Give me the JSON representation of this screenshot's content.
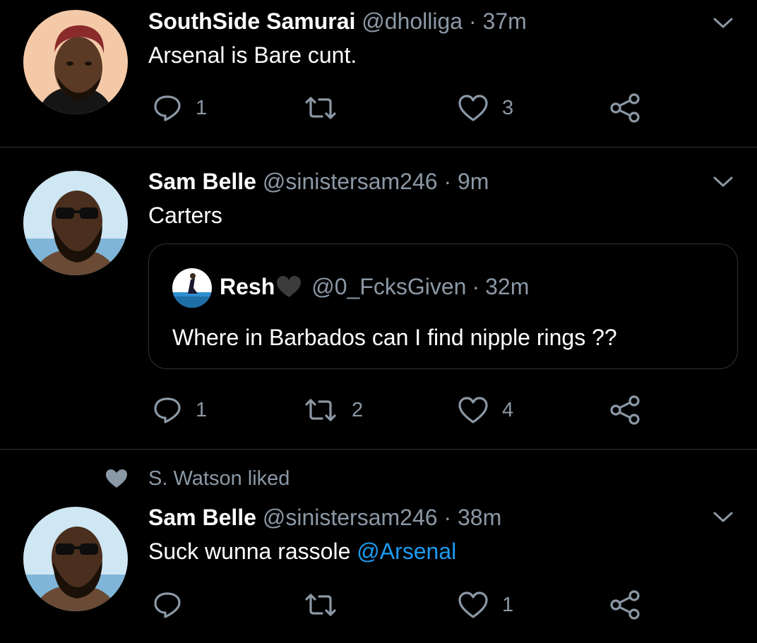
{
  "colors": {
    "background": "#000000",
    "text": "#ffffff",
    "secondary": "#8b98a5",
    "link": "#1d9bf0",
    "divider": "#2f3336"
  },
  "tweets": [
    {
      "name": "SouthSide Samurai",
      "handle": "@dholliga",
      "separator": "·",
      "time": "37m",
      "text": "Arsenal is Bare cunt.",
      "replies": "1",
      "retweets": "",
      "likes": "3"
    },
    {
      "name": "Sam Belle",
      "handle": "@sinistersam246",
      "separator": "·",
      "time": "9m",
      "text": "Carters",
      "quote": {
        "name": "Resh",
        "emoji": "black-heart-icon",
        "handle": "@0_FcksGiven",
        "separator": "·",
        "time": "32m",
        "text": "Where in Barbados can I find nipple rings ??"
      },
      "replies": "1",
      "retweets": "2",
      "likes": "4"
    },
    {
      "social_context": "S. Watson liked",
      "name": "Sam Belle",
      "handle": "@sinistersam246",
      "separator": "·",
      "time": "38m",
      "text_prefix": "Suck wunna rassole ",
      "mention": "@Arsenal",
      "replies": "",
      "retweets": "",
      "likes": "1"
    }
  ]
}
